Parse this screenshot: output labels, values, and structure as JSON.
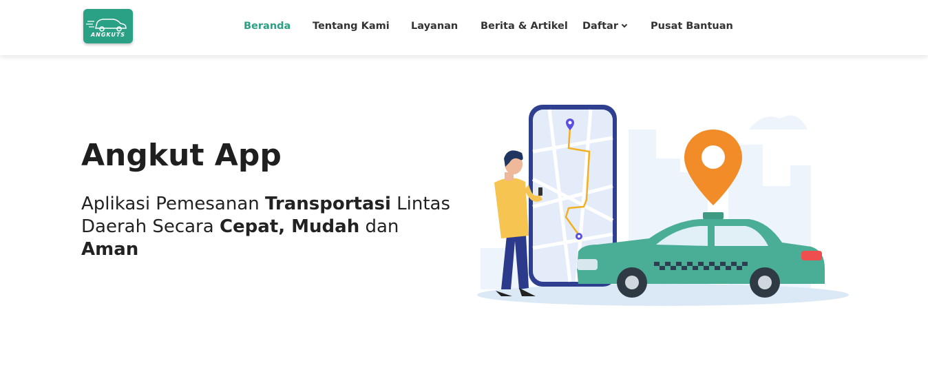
{
  "brand": {
    "logo_text": "ANGKUTS"
  },
  "nav": {
    "items": [
      {
        "label": "Beranda"
      },
      {
        "label": "Tentang Kami"
      },
      {
        "label": "Layanan"
      },
      {
        "label": "Berita & Artikel"
      },
      {
        "label": "Daftar"
      },
      {
        "label": "Pusat Bantuan"
      }
    ]
  },
  "hero": {
    "title": "Angkut App",
    "sub_1": "Aplikasi Pemesanan ",
    "sub_2": "Transportasi",
    "sub_3": " Lintas Daerah Secara ",
    "sub_4": "Cepat, Mudah",
    "sub_5": " dan ",
    "sub_6": "Aman"
  },
  "colors": {
    "accent": "#2aa084",
    "pin": "#f28c28",
    "car": "#4aae96",
    "phone": "#2f3f8f"
  }
}
